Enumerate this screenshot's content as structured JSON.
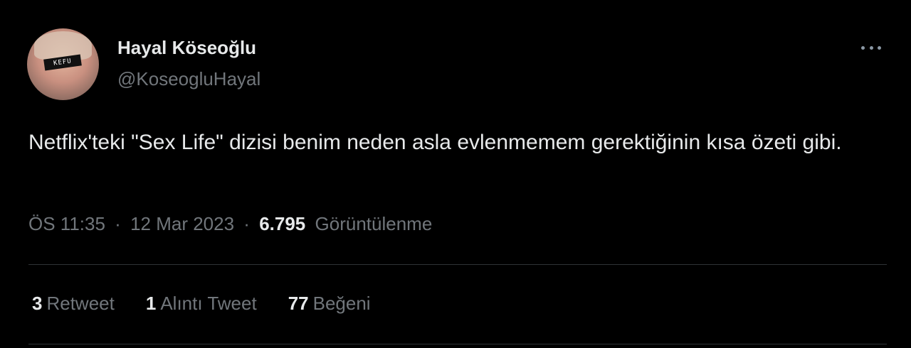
{
  "user": {
    "display_name": "Hayal Köseoğlu",
    "handle": "@KoseogluHayal",
    "avatar_bar_text": "KEFU"
  },
  "tweet": {
    "text": "Netflix'teki \"Sex Life\" dizisi benim neden asla evlenmemem gerektiğinin kısa özeti gibi.",
    "time": "ÖS 11:35",
    "separator": "·",
    "date": "12 Mar 2023",
    "views_count": "6.795",
    "views_label": "Görüntülenme"
  },
  "stats": [
    {
      "count": "3",
      "label": "Retweet"
    },
    {
      "count": "1",
      "label": "Alıntı Tweet"
    },
    {
      "count": "77",
      "label": "Beğeni"
    }
  ],
  "icons": {
    "more": "more-options-icon"
  },
  "colors": {
    "background": "#000000",
    "text_primary": "#e7e9ea",
    "text_secondary": "#71767b",
    "divider": "#2f3336"
  }
}
